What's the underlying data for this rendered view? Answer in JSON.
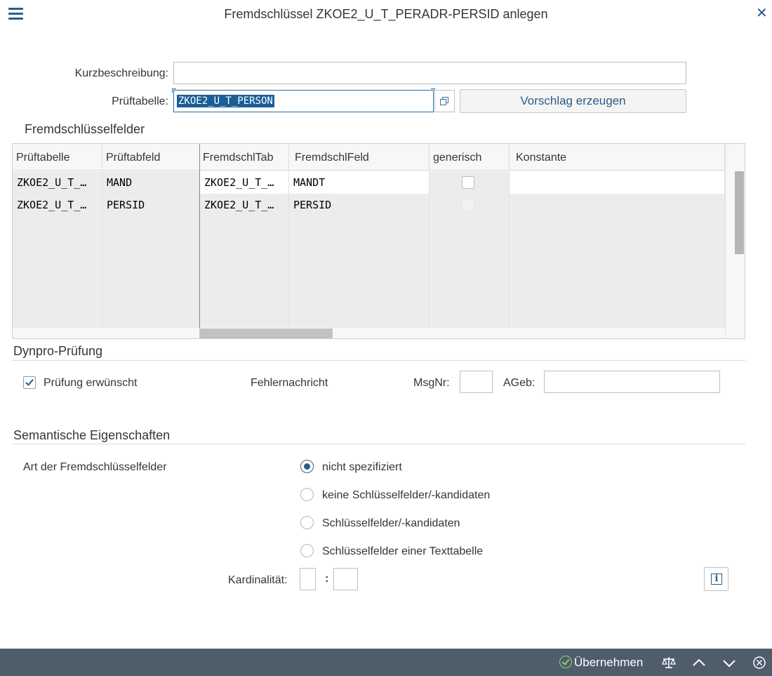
{
  "window": {
    "title": "Fremdschlüssel ZKOE2_U_T_PERADR-PERSID anlegen"
  },
  "form": {
    "kurzbeschreibung_label": "Kurzbeschreibung:",
    "kurzbeschreibung_value": "",
    "prueftabelle_label": "Prüftabelle:",
    "prueftabelle_value": "ZKOE2_U_T_PERSON",
    "proposal_button": "Vorschlag erzeugen"
  },
  "fk_fields": {
    "section_title": "Fremdschlüsselfelder",
    "columns": [
      "Prüftabelle",
      "Prüftabfeld",
      "FremdschlTab",
      "FremdschlFeld",
      "generisch",
      "Konstante"
    ],
    "rows": [
      {
        "prueftabelle": "ZKOE2_U_T_…",
        "prueftabfeld": "MAND",
        "fremdschltab": "ZKOE2_U_T_…",
        "fremdschlfeld": "MANDT",
        "generisch": false,
        "konstante": ""
      },
      {
        "prueftabelle": "ZKOE2_U_T_…",
        "prueftabfeld": "PERSID",
        "fremdschltab": "ZKOE2_U_T_…",
        "fremdschlfeld": "PERSID",
        "generisch": false,
        "konstante": ""
      }
    ]
  },
  "dynpro": {
    "section_title": "Dynpro-Prüfung",
    "check_label": "Prüfung erwünscht",
    "check_checked": true,
    "error_msg_label": "Fehlernachricht",
    "msgnr_label": "MsgNr:",
    "msgnr_value": "",
    "ageb_label": "AGeb:",
    "ageb_value": ""
  },
  "semantic": {
    "section_title": "Semantische Eigenschaften",
    "type_label": "Art der Fremdschlüsselfelder",
    "options": [
      {
        "label": "nicht spezifiziert",
        "selected": true
      },
      {
        "label": "keine Schlüsselfelder/-kandidaten",
        "selected": false
      },
      {
        "label": "Schlüsselfelder/-kandidaten",
        "selected": false
      },
      {
        "label": "Schlüsselfelder einer Texttabelle",
        "selected": false
      }
    ],
    "cardinality_label": "Kardinalität:",
    "cardinality_separator": ":",
    "cardinality_left": "",
    "cardinality_right": ""
  },
  "footer": {
    "apply_label": "Übernehmen"
  },
  "icons": {
    "menu": "menu-icon",
    "close": "close-icon",
    "value_help": "value-help-icon",
    "info": "info-icon",
    "ok": "check-circle-icon",
    "compare": "balance-icon",
    "up": "chevron-up-icon",
    "down": "chevron-down-icon",
    "cancel": "cancel-circle-icon"
  },
  "colors": {
    "accent": "#2a5c8a",
    "selection": "#1a5d97",
    "footer_bg": "#4f5d6b",
    "ok_green": "#8fd46a"
  }
}
